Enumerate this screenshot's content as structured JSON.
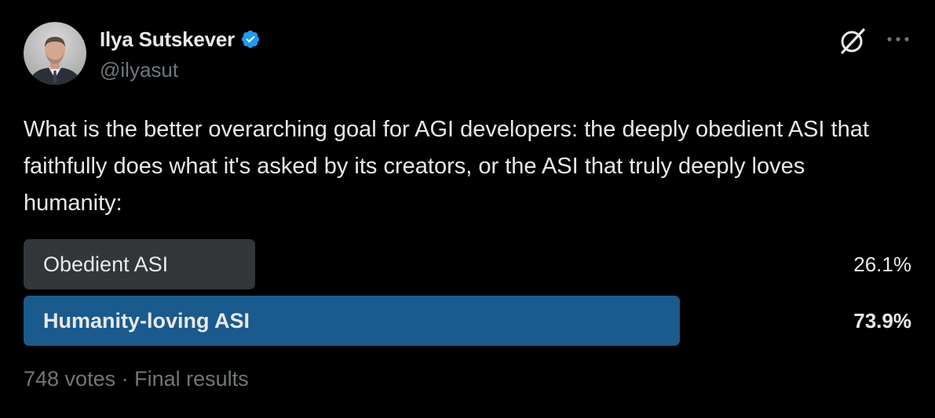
{
  "author": {
    "display_name": "Ilya Sutskever",
    "handle": "@ilyasut",
    "verified": true,
    "avatar_icon": "person-avatar"
  },
  "actions": {
    "grok_icon": "grok-icon",
    "more_icon": "more-horizontal-icon"
  },
  "tweet": {
    "text": "What is the better overarching goal for AGI developers:  the deeply obedient ASI that faithfully does what it's asked by its creators, or the ASI that truly deeply loves humanity:"
  },
  "poll": {
    "options": [
      {
        "label": "Obedient ASI",
        "percent_text": "26.1%",
        "percent": 26.1,
        "winner": false,
        "bar_color": "#333639"
      },
      {
        "label": "Humanity-loving ASI",
        "percent_text": "73.9%",
        "percent": 73.9,
        "winner": true,
        "bar_color": "#1a5a8c"
      }
    ],
    "footer": "748 votes · Final results"
  },
  "colors": {
    "background": "#000000",
    "text_primary": "#e7e9ea",
    "text_secondary": "#71767b",
    "verified_blue": "#1d9bf0"
  }
}
